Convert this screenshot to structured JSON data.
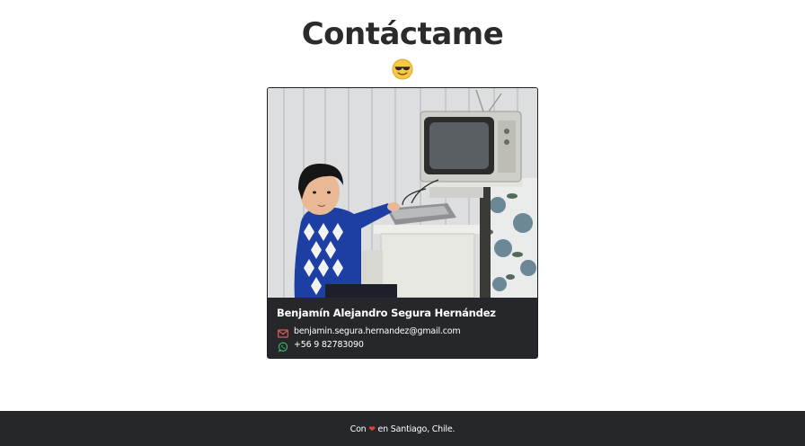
{
  "header": {
    "title": "Contáctame",
    "emoji_icon": "smiling-face-with-sunglasses-icon"
  },
  "card": {
    "photo_icon": "profile-photo",
    "name": "Benjamín Alejandro Segura Hernández",
    "email": {
      "icon": "envelope-icon",
      "value": "benjamin.segura.hernandez@gmail.com",
      "color": "#e05a5a"
    },
    "phone": {
      "icon": "whatsapp-icon",
      "value": "+56 9 82783090",
      "color": "#3fb96a"
    }
  },
  "footer": {
    "prefix": "Con",
    "heart_icon": "heart-icon",
    "suffix": "en Santiago, Chile.",
    "heart_color": "#e0433d"
  },
  "colors": {
    "dark": "#26272b",
    "title": "#2b2b2b",
    "background": "#ffffff"
  }
}
